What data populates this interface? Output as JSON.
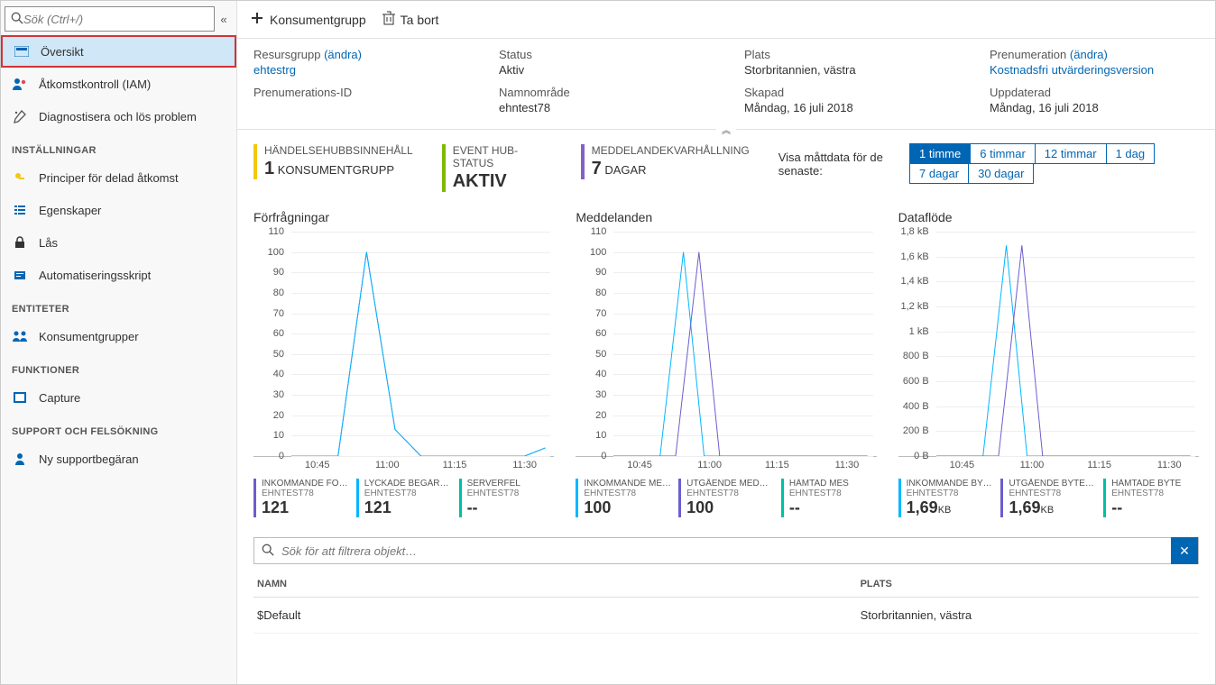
{
  "search": {
    "placeholder": "Sök (Ctrl+/)"
  },
  "sidebar": {
    "items": [
      {
        "label": "Översikt"
      },
      {
        "label": "Åtkomstkontroll (IAM)"
      },
      {
        "label": "Diagnostisera och lös problem"
      }
    ],
    "section_settings": "INSTÄLLNINGAR",
    "settings_items": [
      {
        "label": "Principer för delad åtkomst"
      },
      {
        "label": "Egenskaper"
      },
      {
        "label": "Lås"
      },
      {
        "label": "Automatiseringsskript"
      }
    ],
    "section_entities": "ENTITETER",
    "entities_items": [
      {
        "label": "Konsumentgrupper"
      }
    ],
    "section_functions": "FUNKTIONER",
    "functions_items": [
      {
        "label": "Capture"
      }
    ],
    "section_support": "SUPPORT OCH FELSÖKNING",
    "support_items": [
      {
        "label": "Ny supportbegäran"
      }
    ]
  },
  "toolbar": {
    "add_group": "Konsumentgrupp",
    "delete": "Ta bort"
  },
  "props": {
    "rg_label": "Resursgrupp",
    "rg_change": "(ändra)",
    "rg_value": "ehtestrg",
    "subid_label": "Prenumerations-ID",
    "status_label": "Status",
    "status_value": "Aktiv",
    "ns_label": "Namnområde",
    "ns_value": "ehntest78",
    "loc_label": "Plats",
    "loc_value": "Storbritannien, västra",
    "created_label": "Skapad",
    "created_value": "Måndag, 16 juli 2018",
    "sub_label": "Prenumeration",
    "sub_change": "(ändra)",
    "sub_value": "Kostnadsfri utvärderingsversion",
    "updated_label": "Uppdaterad",
    "updated_value": "Måndag, 16 juli 2018"
  },
  "strip": {
    "content_label": "HÄNDELSEHUBBSINNEHÅLL",
    "content_value_num": "1",
    "content_value_unit": "KONSUMENTGRUPP",
    "status_label": "EVENT HUB-STATUS",
    "status_value": "AKTIV",
    "retention_label": "MEDDELANDEKVARHÅLLNING",
    "retention_value_num": "7",
    "retention_value_unit": "DAGAR"
  },
  "timefilter": {
    "label": "Visa måttdata för de senaste:",
    "buttons": [
      "1 timme",
      "6 timmar",
      "12 timmar",
      "1 dag",
      "7 dagar",
      "30 dagar"
    ],
    "active": 0
  },
  "chart_data": [
    {
      "type": "line",
      "title": "Förfrågningar",
      "xlabel": "",
      "ylabel": "",
      "ylim": [
        0,
        110
      ],
      "x_ticks": [
        "10:45",
        "11:00",
        "11:15",
        "11:30"
      ],
      "series": [
        {
          "name": "INKOMMANDE FORF…",
          "source": "EHNTEST78",
          "color": "#6b5ecd",
          "points": [
            [
              0,
              0
            ],
            [
              18,
              0
            ],
            [
              29,
              100
            ],
            [
              40,
              13
            ],
            [
              50,
              0
            ],
            [
              90,
              0
            ],
            [
              98,
              4
            ]
          ],
          "display_value": "121"
        },
        {
          "name": "LYCKADE BEGÄRANDEN",
          "source": "EHNTEST78",
          "color": "#00b7ff",
          "points": [
            [
              0,
              0
            ],
            [
              18,
              0
            ],
            [
              29,
              100
            ],
            [
              40,
              13
            ],
            [
              50,
              0
            ],
            [
              90,
              0
            ],
            [
              98,
              4
            ]
          ],
          "display_value": "121"
        },
        {
          "name": "SERVERFEL",
          "source": "EHNTEST78",
          "color": "#00bfa5",
          "points": [],
          "display_value": "--"
        }
      ]
    },
    {
      "type": "line",
      "title": "Meddelanden",
      "xlabel": "",
      "ylabel": "",
      "ylim": [
        0,
        110
      ],
      "x_ticks": [
        "10:45",
        "11:00",
        "11:15",
        "11:30"
      ],
      "series": [
        {
          "name": "INKOMMANDE MED…",
          "source": "EHNTEST78",
          "color": "#00b7ff",
          "points": [
            [
              0,
              0
            ],
            [
              18,
              0
            ],
            [
              27,
              100
            ],
            [
              35,
              0
            ],
            [
              98,
              0
            ]
          ],
          "display_value": "100"
        },
        {
          "name": "UTGÅENDE MEDD…",
          "source": "EHNTEST78",
          "color": "#6b5ecd",
          "points": [
            [
              0,
              0
            ],
            [
              24,
              0
            ],
            [
              33,
              100
            ],
            [
              41,
              0
            ],
            [
              98,
              0
            ]
          ],
          "display_value": "100"
        },
        {
          "name": "HÄMTAD MES",
          "source": "EHNTEST78",
          "color": "#00bfa5",
          "points": [],
          "display_value": "--"
        }
      ]
    },
    {
      "type": "line",
      "title": "Dataflöde",
      "xlabel": "",
      "ylabel": "",
      "ylim": [
        0,
        1800
      ],
      "y_tick_labels": [
        "0 B",
        "200 B",
        "400 B",
        "600 B",
        "800 B",
        "1 kB",
        "1,2 kB",
        "1,4 kB",
        "1,6 kB",
        "1,8 kB"
      ],
      "x_ticks": [
        "10:45",
        "11:00",
        "11:15",
        "11:30"
      ],
      "series": [
        {
          "name": "INKOMMANDE BYTE (…",
          "source": "EHNTEST78",
          "color": "#00b7ff",
          "points": [
            [
              0,
              0
            ],
            [
              18,
              0
            ],
            [
              27,
              1690
            ],
            [
              35,
              0
            ],
            [
              98,
              0
            ]
          ],
          "display_value": "1,69",
          "unit": "KB"
        },
        {
          "name": "UTGÅENDE BYTE (…",
          "source": "EHNTEST78",
          "color": "#6b5ecd",
          "points": [
            [
              0,
              0
            ],
            [
              24,
              0
            ],
            [
              33,
              1690
            ],
            [
              41,
              0
            ],
            [
              98,
              0
            ]
          ],
          "display_value": "1,69",
          "unit": "KB"
        },
        {
          "name": "HÄMTADE BYTE",
          "source": "EHNTEST78",
          "color": "#00bfa5",
          "points": [],
          "display_value": "--"
        }
      ]
    }
  ],
  "filter": {
    "placeholder": "Sök för att filtrera objekt…"
  },
  "table": {
    "col_name": "NAMN",
    "col_loc": "PLATS",
    "rows": [
      {
        "name": "$Default",
        "loc": "Storbritannien, västra"
      }
    ]
  }
}
